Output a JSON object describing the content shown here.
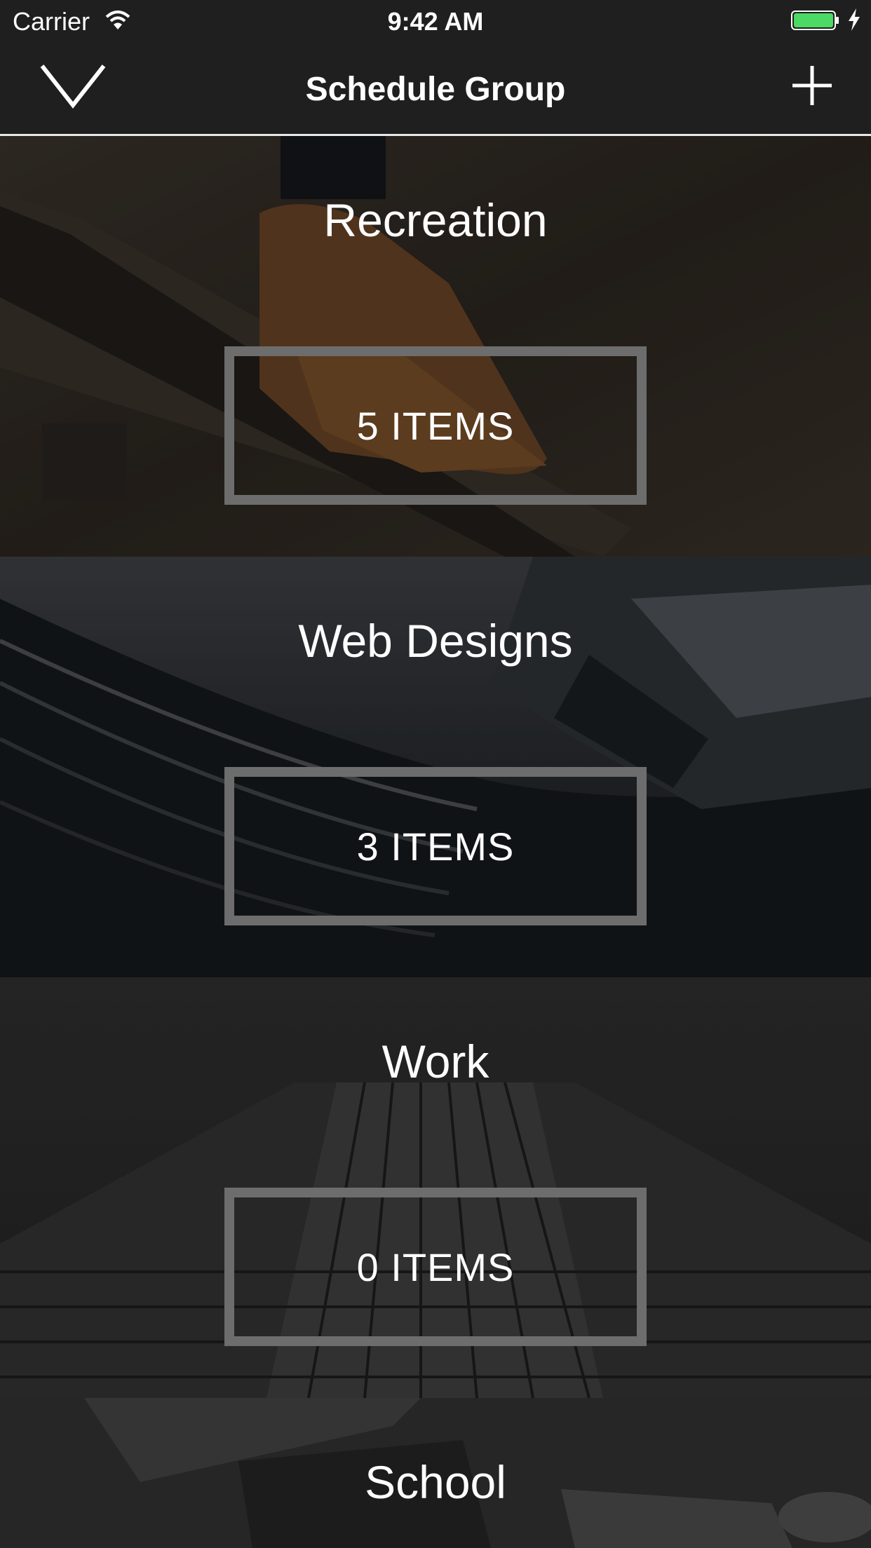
{
  "status_bar": {
    "carrier": "Carrier",
    "time": "9:42 AM",
    "battery_color": "#4cd964"
  },
  "nav": {
    "title": "Schedule Group",
    "back_icon": "chevron-down-icon",
    "add_icon": "plus-icon"
  },
  "groups": [
    {
      "title": "Recreation",
      "count": "5 ITEMS"
    },
    {
      "title": "Web Designs",
      "count": "3 ITEMS"
    },
    {
      "title": "Work",
      "count": "0 ITEMS"
    },
    {
      "title": "School"
    }
  ]
}
